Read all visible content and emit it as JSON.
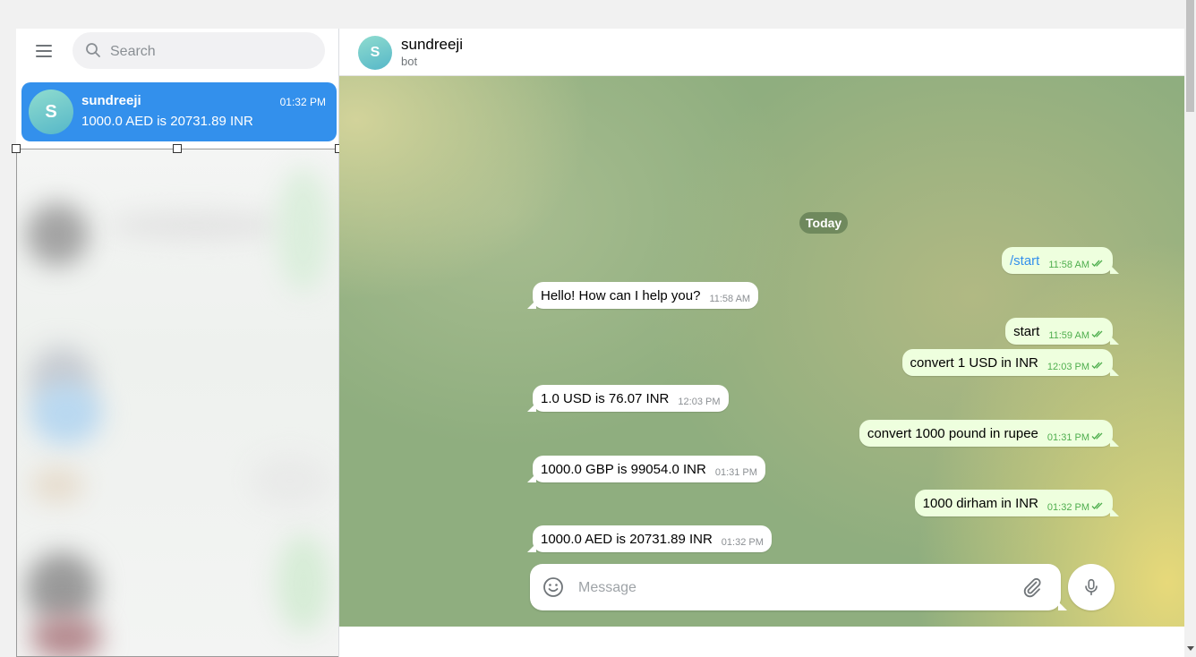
{
  "sidebar": {
    "search_placeholder": "Search",
    "active_chat": {
      "avatar_letter": "S",
      "name": "sundreeji",
      "time": "01:32 PM",
      "preview": "1000.0 AED is 20731.89 INR"
    }
  },
  "header": {
    "avatar_letter": "S",
    "title": "sundreeji",
    "subtitle": "bot"
  },
  "date_label": "Today",
  "messages": [
    {
      "dir": "out",
      "text": "/start",
      "time": "11:58 AM",
      "is_command": true
    },
    {
      "dir": "in",
      "text": "Hello! How can I help you?",
      "time": "11:58 AM"
    },
    {
      "dir": "out",
      "text": "start",
      "time": "11:59 AM"
    },
    {
      "dir": "out",
      "text": "convert  1 USD in INR",
      "time": "12:03 PM"
    },
    {
      "dir": "in",
      "text": "1.0 USD is 76.07 INR",
      "time": "12:03 PM"
    },
    {
      "dir": "out",
      "text": "convert 1000 pound in rupee",
      "time": "01:31 PM"
    },
    {
      "dir": "in",
      "text": "1000.0 GBP is 99054.0 INR",
      "time": "01:31 PM"
    },
    {
      "dir": "out",
      "text": "1000 dirham in INR",
      "time": "01:32 PM"
    },
    {
      "dir": "in",
      "text": "1000.0 AED is 20731.89 INR",
      "time": "01:32 PM"
    }
  ],
  "composer": {
    "placeholder": "Message"
  },
  "colors": {
    "accent": "#3390ec",
    "outgoing_bubble": "#eeffde",
    "outgoing_time": "#4fae4e"
  }
}
